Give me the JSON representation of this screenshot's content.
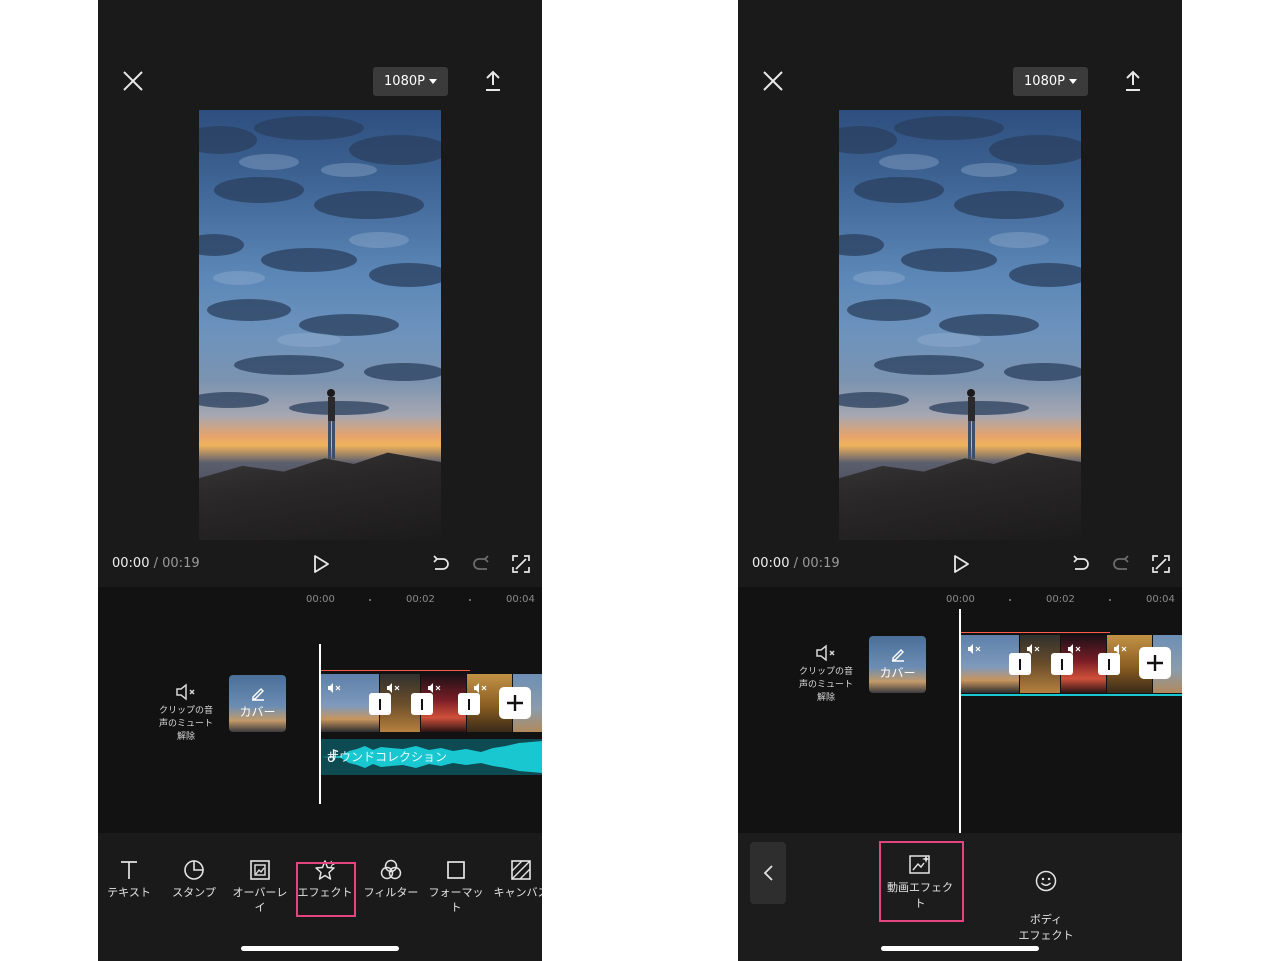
{
  "left_screen": {
    "resolution": "1080P",
    "timecode_current": "00:00",
    "timecode_separator": "/",
    "timecode_total": "00:19",
    "ruler": [
      "00:00",
      "00:02",
      "00:04"
    ],
    "mute_label": "クリップの音\n声のミュート\n解除",
    "cover_label": "カバー",
    "audio_label": "サウンドコレクション",
    "tools": [
      {
        "label": "テキスト",
        "icon": "text-icon"
      },
      {
        "label": "スタンプ",
        "icon": "sticker-icon"
      },
      {
        "label": "オーバーレイ",
        "icon": "overlay-icon"
      },
      {
        "label": "エフェクト",
        "icon": "effect-icon",
        "highlighted": true
      },
      {
        "label": "フィルター",
        "icon": "filter-icon"
      },
      {
        "label": "フォーマット",
        "icon": "format-icon"
      },
      {
        "label": "キャンバス",
        "icon": "canvas-icon"
      }
    ]
  },
  "right_screen": {
    "resolution": "1080P",
    "timecode_current": "00:00",
    "timecode_separator": "/",
    "timecode_total": "00:19",
    "ruler": [
      "00:00",
      "00:02",
      "00:04"
    ],
    "mute_label": "クリップの音\n声のミュート\n解除",
    "cover_label": "カバー",
    "effect_options": [
      {
        "label": "動画エフェクト",
        "icon": "video-effect-icon",
        "highlighted": true
      },
      {
        "label": "ボディ\nエフェクト",
        "icon": "body-effect-icon"
      }
    ]
  },
  "colors": {
    "background": "#1a1a1a",
    "timeline_bg": "#121212",
    "highlight": "#e2457f",
    "audio_wave": "#19c7d1",
    "trim_line": "#ff5a4a"
  }
}
